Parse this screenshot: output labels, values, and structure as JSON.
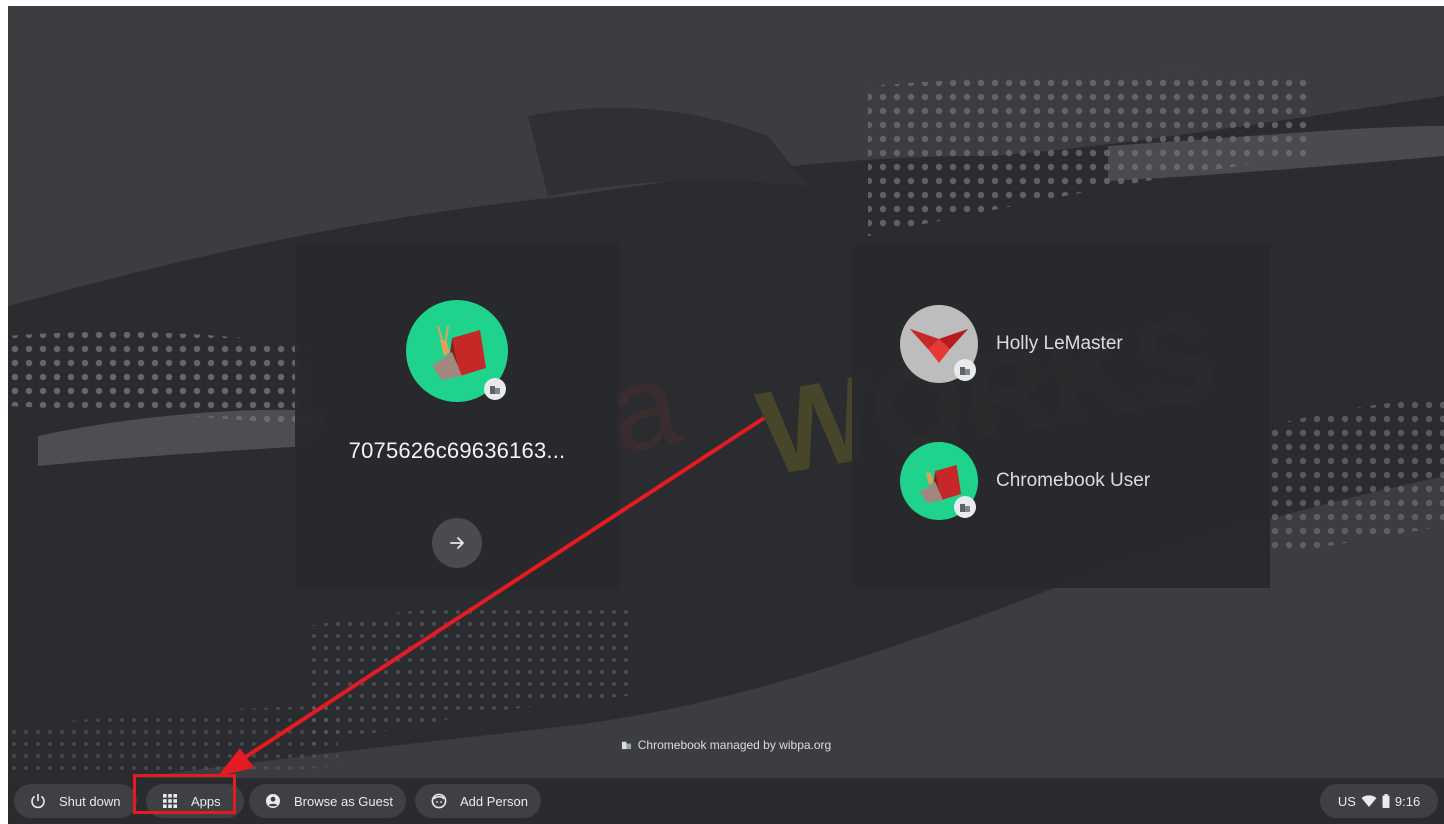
{
  "watermark": {
    "text_left": "SCPa",
    "text_right": "WORKS"
  },
  "primary_user": {
    "name": "7075626c69636163...",
    "avatar_icon": "origami-snail-icon",
    "avatar_color": "#1fd38c",
    "badge_icon": "enterprise-building-icon",
    "submit_icon": "arrow-right-icon"
  },
  "user_list": [
    {
      "name": "Holly LeMaster",
      "avatar_icon": "origami-bird-icon",
      "avatar_color": "#bdbdbd"
    },
    {
      "name": "Chromebook User",
      "avatar_icon": "origami-snail-icon",
      "avatar_color": "#1fd38c"
    }
  ],
  "managed_note": "Chromebook managed by wibpa.org",
  "shelf": {
    "shutdown_label": "Shut down",
    "apps_label": "Apps",
    "guest_label": "Browse as Guest",
    "add_person_label": "Add Person"
  },
  "status": {
    "keyboard_layout": "US",
    "time": "9:16"
  },
  "annotation": {
    "color": "#e51b23",
    "target": "apps-button"
  }
}
